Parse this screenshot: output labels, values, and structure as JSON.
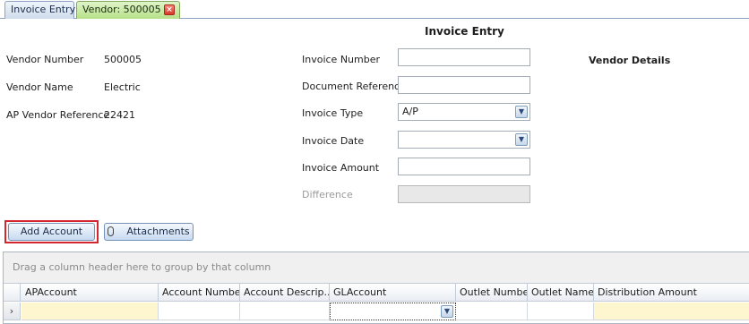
{
  "tabs": [
    {
      "label": "Invoice Entry"
    },
    {
      "label": "Vendor: 500005"
    }
  ],
  "header": {
    "title": "Invoice Entry"
  },
  "vendor": {
    "number_label": "Vendor Number",
    "number_value": "500005",
    "name_label": "Vendor Name",
    "name_value": "Electric",
    "ap_ref_label": "AP Vendor Reference",
    "ap_ref_value": "22421",
    "details_heading": "Vendor Details"
  },
  "form": {
    "invoice_number": {
      "label": "Invoice Number",
      "value": ""
    },
    "document_reference": {
      "label": "Document Reference",
      "value": ""
    },
    "invoice_type": {
      "label": "Invoice Type",
      "value": "A/P"
    },
    "invoice_date": {
      "label": "Invoice Date",
      "value": ""
    },
    "invoice_amount": {
      "label": "Invoice Amount",
      "value": ""
    },
    "difference": {
      "label": "Difference",
      "value": ""
    }
  },
  "buttons": {
    "add_account": "Add Account",
    "attachments": "Attachments"
  },
  "icons": {
    "tab_close": "close-icon",
    "paperclip": "paperclip-icon",
    "dropdown": "chevron-down-icon",
    "row_indicator": "chevron-right-icon"
  },
  "grid": {
    "group_hint": "Drag a column header here to group by that column",
    "columns": [
      "APAccount",
      "Account Number",
      "Account Descrip...",
      "GLAccount",
      "Outlet Number",
      "Outlet Name",
      "Distribution Amount"
    ],
    "row_indicator": "›"
  },
  "colors": {
    "active_tab": "#b6e088",
    "focus_ring": "#d3262f",
    "required_cell": "#fdf6cf"
  }
}
